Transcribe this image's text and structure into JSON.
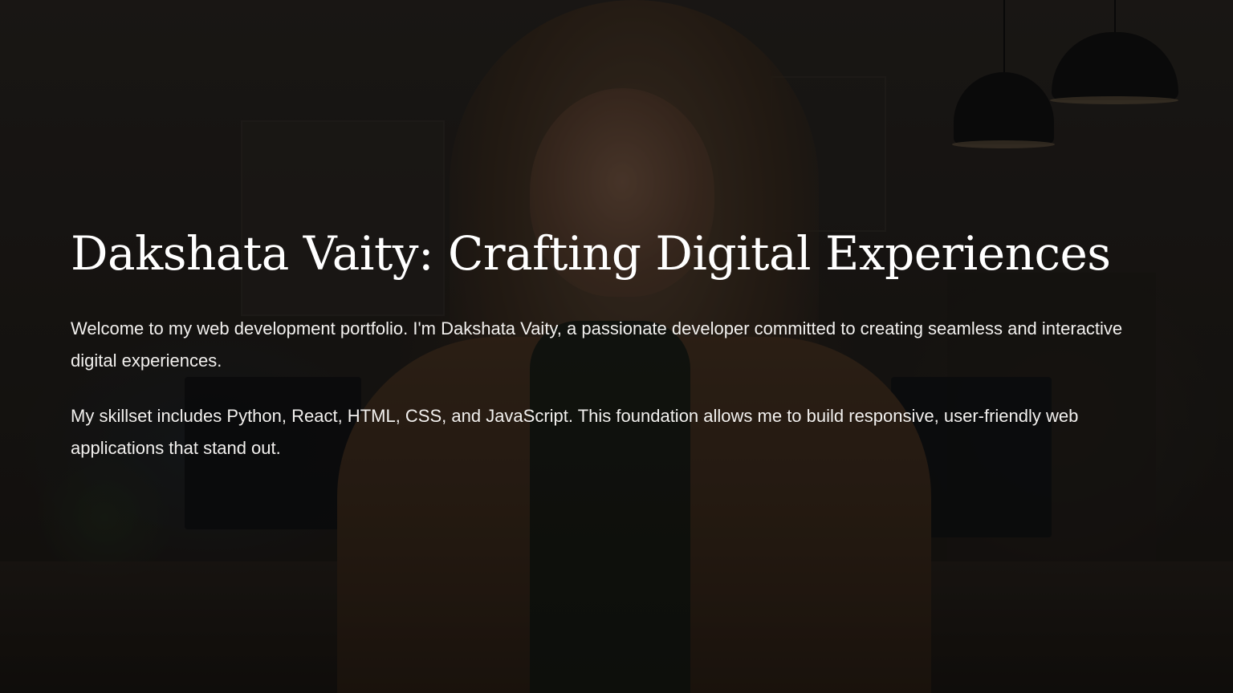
{
  "slide": {
    "title": "Dakshata Vaity: Crafting Digital Experiences",
    "paragraphs": [
      "Welcome to my web development portfolio. I'm Dakshata Vaity, a passionate developer committed to creating seamless and interactive digital experiences.",
      "My skillset includes Python, React, HTML, CSS, and JavaScript. This foundation allows me to build responsive, user-friendly web applications that stand out."
    ]
  },
  "colors": {
    "text": "#ffffff",
    "overlay": "rgba(0,0,0,0.42)"
  }
}
